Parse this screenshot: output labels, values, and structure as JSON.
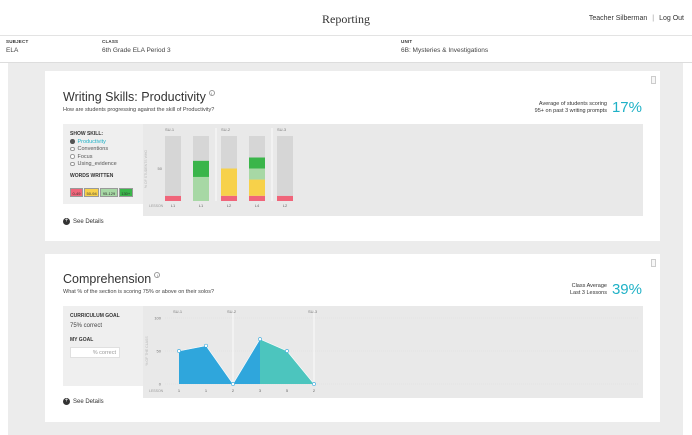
{
  "header": {
    "title": "Reporting",
    "teacher": "Teacher Silberman",
    "separator": "|",
    "logout": "Log Out"
  },
  "filters": [
    {
      "label": "SUBJECT",
      "value": "ELA"
    },
    {
      "label": "CLASS",
      "value": "6th Grade ELA Period 3"
    },
    {
      "label": "UNIT",
      "value": "6B: Mysteries & Investigations"
    }
  ],
  "productivity": {
    "title": "Writing Skills: Productivity",
    "info": "i",
    "question": "How are students progressing against the skill of Productivity?",
    "stat_label_1": "Average of students scoring",
    "stat_label_2": "95+ on past 3 writing prompts",
    "stat_value": "17%",
    "show_skill_label": "SHOW SKILL:",
    "skills": [
      "Productivity",
      "Conventions",
      "Focus",
      "Using_evidence"
    ],
    "selected_skill": "Productivity",
    "words_written_label": "WORDS WRITTEN",
    "word_ranges": [
      {
        "label": "0-49",
        "color": "#f0657a"
      },
      {
        "label": "50-94",
        "color": "#f7d14a"
      },
      {
        "label": "95-129",
        "color": "#a7d8a5"
      },
      {
        "label": "130+",
        "color": "#3ab54a"
      }
    ],
    "see_details": "See Details"
  },
  "comprehension": {
    "title": "Comprehension",
    "info": "i",
    "question": "What % of the section is scoring 75% or above on their solos?",
    "stat_label_1": "Class Average",
    "stat_label_2": "Last 3 Lessons",
    "stat_value": "39%",
    "curriculum_goal_label": "CURRICULUM GOAL",
    "curriculum_goal_value": "75% correct",
    "my_goal_label": "MY GOAL",
    "my_goal_placeholder": "% correct",
    "see_details": "See Details"
  },
  "chart_data": [
    {
      "type": "bar",
      "stacked": true,
      "xlabel": "LESSON",
      "ylabel": "% OF STUDENTS WHO",
      "ylim": [
        0,
        100
      ],
      "yticks": [
        50
      ],
      "groups": [
        {
          "label": "SU-1",
          "start": 0
        },
        {
          "label": "SU-2",
          "start": 2
        },
        {
          "label": "SU-3",
          "start": 4
        }
      ],
      "categories": [
        "L1",
        "L1",
        "L2",
        "L4",
        "L2"
      ],
      "series": [
        {
          "name": "0-49",
          "color": "#f0657a",
          "values": [
            8,
            0,
            8,
            8,
            8
          ]
        },
        {
          "name": "50-94",
          "color": "#f7d14a",
          "values": [
            0,
            0,
            42,
            25,
            0
          ]
        },
        {
          "name": "95-129",
          "color": "#a7d8a5",
          "values": [
            0,
            37,
            0,
            17,
            0
          ]
        },
        {
          "name": "130+",
          "color": "#3ab54a",
          "values": [
            0,
            25,
            0,
            17,
            0
          ]
        }
      ],
      "remainder_color": "#d6d6d6"
    },
    {
      "type": "area",
      "xlabel": "LESSON",
      "ylabel": "% OF THE CLASS",
      "ylim": [
        0,
        100
      ],
      "yticks": [
        0,
        50,
        100
      ],
      "groups": [
        {
          "label": "SU-1",
          "start": 0
        },
        {
          "label": "SU-2",
          "start": 2
        },
        {
          "label": "SU-3",
          "start": 5
        }
      ],
      "categories": [
        "1",
        "1",
        "2",
        "3",
        "5",
        "2"
      ],
      "values": [
        50,
        58,
        0,
        68,
        50,
        0
      ],
      "segments": [
        {
          "from": 0,
          "to": 2,
          "color": "#2fa6dc"
        },
        {
          "from": 2,
          "to": 3,
          "color": "#2fa6dc"
        },
        {
          "from": 3,
          "to": 5,
          "color": "#4cc5be"
        }
      ]
    }
  ]
}
